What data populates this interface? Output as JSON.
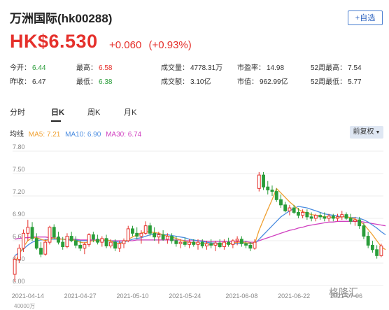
{
  "header": {
    "title": "万洲国际(hk00288)",
    "follow_label": "+自选"
  },
  "quote": {
    "price": "HK$6.530",
    "change": "+0.060",
    "change_pct": "(+0.93%)"
  },
  "stats": [
    {
      "label": "今开：",
      "value": "6.44",
      "color": "green"
    },
    {
      "label": "最高：",
      "value": "6.58",
      "color": "red"
    },
    {
      "label": "成交量：",
      "value": "4778.31万",
      "color": "none"
    },
    {
      "label": "市盈率：",
      "value": "14.98",
      "color": "none"
    },
    {
      "label": "52周最高：",
      "value": "7.54",
      "color": "none"
    },
    {
      "label": "昨收：",
      "value": "6.47",
      "color": "none"
    },
    {
      "label": "最低：",
      "value": "6.38",
      "color": "green"
    },
    {
      "label": "成交额：",
      "value": "3.10亿",
      "color": "none"
    },
    {
      "label": "市值：",
      "value": "962.99亿",
      "color": "none"
    },
    {
      "label": "52周最低：",
      "value": "5.77",
      "color": "none"
    }
  ],
  "tabs": [
    {
      "label": "分时"
    },
    {
      "label": "日K"
    },
    {
      "label": "周K"
    },
    {
      "label": "月K"
    }
  ],
  "ma_legend": {
    "label": "均线",
    "ma5": "MA5: 7.21",
    "ma10": "MA10: 6.90",
    "ma30": "MA30: 6.74",
    "ma5_color": "#f0a030",
    "ma10_color": "#4a8ce0",
    "ma30_color": "#d040c0"
  },
  "adjust_label": "前复权",
  "watermark": "格隆汇",
  "volume_label": "40000万",
  "chart_data": {
    "type": "candlestick",
    "y_ticks": [
      "7.80",
      "7.50",
      "7.20",
      "6.90",
      "6.60",
      "6.30",
      "6.00"
    ],
    "ylim": [
      6.0,
      7.8
    ],
    "x_ticks": [
      "2021-04-14",
      "2021-04-27",
      "2021-05-10",
      "2021-05-24",
      "2021-06-08",
      "2021-06-22",
      "2021-07-06"
    ],
    "up_color": "#e5302b",
    "down_color": "#2a9d3a",
    "candles": [
      {
        "o": 6.15,
        "h": 6.4,
        "l": 6.05,
        "c": 6.35
      },
      {
        "o": 6.35,
        "h": 6.55,
        "l": 6.3,
        "c": 6.5
      },
      {
        "o": 6.5,
        "h": 6.75,
        "l": 6.45,
        "c": 6.7
      },
      {
        "o": 6.7,
        "h": 6.88,
        "l": 6.6,
        "c": 6.78
      },
      {
        "o": 6.78,
        "h": 6.85,
        "l": 6.6,
        "c": 6.63
      },
      {
        "o": 6.63,
        "h": 6.7,
        "l": 6.48,
        "c": 6.5
      },
      {
        "o": 6.5,
        "h": 6.58,
        "l": 6.38,
        "c": 6.42
      },
      {
        "o": 6.42,
        "h": 6.62,
        "l": 6.4,
        "c": 6.58
      },
      {
        "o": 6.58,
        "h": 6.8,
        "l": 6.55,
        "c": 6.78
      },
      {
        "o": 6.78,
        "h": 6.82,
        "l": 6.62,
        "c": 6.65
      },
      {
        "o": 6.65,
        "h": 6.72,
        "l": 6.55,
        "c": 6.58
      },
      {
        "o": 6.58,
        "h": 6.65,
        "l": 6.48,
        "c": 6.52
      },
      {
        "o": 6.52,
        "h": 6.7,
        "l": 6.5,
        "c": 6.66
      },
      {
        "o": 6.66,
        "h": 6.72,
        "l": 6.58,
        "c": 6.6
      },
      {
        "o": 6.6,
        "h": 6.66,
        "l": 6.5,
        "c": 6.54
      },
      {
        "o": 6.54,
        "h": 6.6,
        "l": 6.46,
        "c": 6.5
      },
      {
        "o": 6.5,
        "h": 6.58,
        "l": 6.42,
        "c": 6.55
      },
      {
        "o": 6.55,
        "h": 6.7,
        "l": 6.52,
        "c": 6.68
      },
      {
        "o": 6.68,
        "h": 6.72,
        "l": 6.58,
        "c": 6.62
      },
      {
        "o": 6.62,
        "h": 6.68,
        "l": 6.55,
        "c": 6.58
      },
      {
        "o": 6.58,
        "h": 6.66,
        "l": 6.52,
        "c": 6.63
      },
      {
        "o": 6.63,
        "h": 6.68,
        "l": 6.5,
        "c": 6.53
      },
      {
        "o": 6.53,
        "h": 6.62,
        "l": 6.5,
        "c": 6.58
      },
      {
        "o": 6.58,
        "h": 6.62,
        "l": 6.46,
        "c": 6.5
      },
      {
        "o": 6.5,
        "h": 6.6,
        "l": 6.45,
        "c": 6.56
      },
      {
        "o": 6.56,
        "h": 6.63,
        "l": 6.5,
        "c": 6.6
      },
      {
        "o": 6.6,
        "h": 6.8,
        "l": 6.58,
        "c": 6.76
      },
      {
        "o": 6.76,
        "h": 6.8,
        "l": 6.66,
        "c": 6.7
      },
      {
        "o": 6.7,
        "h": 6.78,
        "l": 6.62,
        "c": 6.66
      },
      {
        "o": 6.66,
        "h": 6.74,
        "l": 6.56,
        "c": 6.7
      },
      {
        "o": 6.7,
        "h": 6.86,
        "l": 6.68,
        "c": 6.8
      },
      {
        "o": 6.8,
        "h": 6.84,
        "l": 6.66,
        "c": 6.7
      },
      {
        "o": 6.7,
        "h": 6.78,
        "l": 6.6,
        "c": 6.65
      },
      {
        "o": 6.65,
        "h": 6.72,
        "l": 6.56,
        "c": 6.68
      },
      {
        "o": 6.68,
        "h": 6.74,
        "l": 6.6,
        "c": 6.62
      },
      {
        "o": 6.62,
        "h": 6.7,
        "l": 6.56,
        "c": 6.66
      },
      {
        "o": 6.66,
        "h": 6.7,
        "l": 6.56,
        "c": 6.6
      },
      {
        "o": 6.6,
        "h": 6.66,
        "l": 6.52,
        "c": 6.56
      },
      {
        "o": 6.56,
        "h": 6.62,
        "l": 6.5,
        "c": 6.58
      },
      {
        "o": 6.58,
        "h": 6.64,
        "l": 6.52,
        "c": 6.55
      },
      {
        "o": 6.55,
        "h": 6.62,
        "l": 6.5,
        "c": 6.58
      },
      {
        "o": 6.58,
        "h": 6.62,
        "l": 6.52,
        "c": 6.55
      },
      {
        "o": 6.55,
        "h": 6.62,
        "l": 6.48,
        "c": 6.58
      },
      {
        "o": 6.58,
        "h": 6.62,
        "l": 6.5,
        "c": 6.53
      },
      {
        "o": 6.53,
        "h": 6.6,
        "l": 6.48,
        "c": 6.56
      },
      {
        "o": 6.56,
        "h": 6.62,
        "l": 6.5,
        "c": 6.54
      },
      {
        "o": 6.54,
        "h": 6.6,
        "l": 6.46,
        "c": 6.57
      },
      {
        "o": 6.57,
        "h": 6.62,
        "l": 6.5,
        "c": 6.52
      },
      {
        "o": 6.52,
        "h": 6.62,
        "l": 6.48,
        "c": 6.58
      },
      {
        "o": 6.58,
        "h": 6.64,
        "l": 6.52,
        "c": 6.55
      },
      {
        "o": 6.55,
        "h": 6.62,
        "l": 6.5,
        "c": 6.6
      },
      {
        "o": 6.6,
        "h": 6.66,
        "l": 6.54,
        "c": 6.62
      },
      {
        "o": 6.62,
        "h": 6.66,
        "l": 6.52,
        "c": 6.56
      },
      {
        "o": 6.56,
        "h": 6.6,
        "l": 6.5,
        "c": 6.54
      },
      {
        "o": 6.54,
        "h": 6.58,
        "l": 6.46,
        "c": 6.5
      },
      {
        "o": 6.5,
        "h": 6.62,
        "l": 6.48,
        "c": 6.58
      },
      {
        "o": 7.3,
        "h": 7.52,
        "l": 7.26,
        "c": 7.48
      },
      {
        "o": 7.48,
        "h": 7.52,
        "l": 7.28,
        "c": 7.32
      },
      {
        "o": 7.32,
        "h": 7.4,
        "l": 7.22,
        "c": 7.28
      },
      {
        "o": 7.28,
        "h": 7.34,
        "l": 7.2,
        "c": 7.26
      },
      {
        "o": 7.26,
        "h": 7.3,
        "l": 7.12,
        "c": 7.15
      },
      {
        "o": 7.15,
        "h": 7.22,
        "l": 7.04,
        "c": 7.08
      },
      {
        "o": 7.08,
        "h": 7.12,
        "l": 6.98,
        "c": 7.0
      },
      {
        "o": 7.0,
        "h": 7.08,
        "l": 6.94,
        "c": 7.04
      },
      {
        "o": 7.04,
        "h": 7.08,
        "l": 6.96,
        "c": 6.98
      },
      {
        "o": 6.98,
        "h": 7.04,
        "l": 6.9,
        "c": 6.94
      },
      {
        "o": 6.94,
        "h": 7.02,
        "l": 6.9,
        "c": 6.98
      },
      {
        "o": 6.98,
        "h": 7.02,
        "l": 6.88,
        "c": 6.92
      },
      {
        "o": 6.92,
        "h": 6.98,
        "l": 6.86,
        "c": 6.9
      },
      {
        "o": 6.9,
        "h": 6.96,
        "l": 6.86,
        "c": 6.94
      },
      {
        "o": 6.94,
        "h": 6.98,
        "l": 6.88,
        "c": 6.92
      },
      {
        "o": 6.92,
        "h": 6.98,
        "l": 6.86,
        "c": 6.9
      },
      {
        "o": 6.9,
        "h": 6.96,
        "l": 6.86,
        "c": 6.93
      },
      {
        "o": 6.93,
        "h": 6.96,
        "l": 6.86,
        "c": 6.9
      },
      {
        "o": 6.9,
        "h": 6.96,
        "l": 6.86,
        "c": 6.92
      },
      {
        "o": 6.92,
        "h": 7.0,
        "l": 6.88,
        "c": 6.95
      },
      {
        "o": 6.95,
        "h": 6.98,
        "l": 6.88,
        "c": 6.9
      },
      {
        "o": 6.9,
        "h": 6.96,
        "l": 6.82,
        "c": 6.86
      },
      {
        "o": 6.86,
        "h": 6.92,
        "l": 6.8,
        "c": 6.88
      },
      {
        "o": 6.88,
        "h": 6.92,
        "l": 6.76,
        "c": 6.8
      },
      {
        "o": 6.8,
        "h": 6.84,
        "l": 6.62,
        "c": 6.66
      },
      {
        "o": 6.66,
        "h": 6.72,
        "l": 6.5,
        "c": 6.54
      },
      {
        "o": 6.54,
        "h": 6.6,
        "l": 6.44,
        "c": 6.48
      },
      {
        "o": 6.48,
        "h": 6.54,
        "l": 6.36,
        "c": 6.4
      },
      {
        "o": 6.4,
        "h": 6.56,
        "l": 6.38,
        "c": 6.53
      }
    ],
    "ma5": [
      6.3,
      6.42,
      6.52,
      6.6,
      6.64,
      6.64,
      6.62,
      6.6,
      6.62,
      6.64,
      6.62,
      6.62,
      6.62,
      6.62,
      6.6,
      6.58,
      6.57,
      6.59,
      6.6,
      6.6,
      6.61,
      6.61,
      6.6,
      6.57,
      6.56,
      6.58,
      6.62,
      6.65,
      6.68,
      6.7,
      6.72,
      6.72,
      6.71,
      6.7,
      6.68,
      6.66,
      6.65,
      6.63,
      6.61,
      6.59,
      6.58,
      6.57,
      6.57,
      6.56,
      6.56,
      6.55,
      6.56,
      6.55,
      6.56,
      6.56,
      6.57,
      6.58,
      6.58,
      6.57,
      6.57,
      6.56,
      6.74,
      6.88,
      7.02,
      7.15,
      7.3,
      7.24,
      7.18,
      7.12,
      7.07,
      7.02,
      6.99,
      6.97,
      6.95,
      6.94,
      6.93,
      6.92,
      6.92,
      6.91,
      6.91,
      6.92,
      6.92,
      6.91,
      6.89,
      6.86,
      6.82,
      6.75,
      6.68,
      6.6,
      6.52,
      6.48
    ],
    "ma10": [
      6.4,
      6.44,
      6.49,
      6.54,
      6.58,
      6.6,
      6.61,
      6.61,
      6.62,
      6.62,
      6.62,
      6.62,
      6.61,
      6.61,
      6.61,
      6.6,
      6.6,
      6.6,
      6.6,
      6.6,
      6.6,
      6.6,
      6.6,
      6.59,
      6.58,
      6.58,
      6.6,
      6.62,
      6.63,
      6.64,
      6.66,
      6.68,
      6.69,
      6.69,
      6.68,
      6.68,
      6.67,
      6.66,
      6.65,
      6.64,
      6.62,
      6.61,
      6.6,
      6.59,
      6.58,
      6.57,
      6.57,
      6.56,
      6.56,
      6.56,
      6.56,
      6.56,
      6.57,
      6.57,
      6.56,
      6.56,
      6.62,
      6.68,
      6.74,
      6.8,
      6.86,
      6.92,
      6.96,
      7.0,
      7.03,
      7.06,
      7.05,
      7.04,
      7.02,
      7.0,
      6.98,
      6.96,
      6.95,
      6.94,
      6.93,
      6.92,
      6.92,
      6.91,
      6.91,
      6.9,
      6.88,
      6.85,
      6.81,
      6.77,
      6.72,
      6.68
    ],
    "ma30": [
      6.62,
      6.63,
      6.64,
      6.64,
      6.65,
      6.65,
      6.65,
      6.65,
      6.64,
      6.64,
      6.63,
      6.62,
      6.62,
      6.62,
      6.62,
      6.61,
      6.61,
      6.61,
      6.61,
      6.61,
      6.61,
      6.61,
      6.6,
      6.6,
      6.6,
      6.6,
      6.6,
      6.6,
      6.61,
      6.61,
      6.61,
      6.61,
      6.61,
      6.61,
      6.61,
      6.61,
      6.61,
      6.61,
      6.61,
      6.6,
      6.6,
      6.6,
      6.6,
      6.6,
      6.59,
      6.59,
      6.59,
      6.59,
      6.59,
      6.59,
      6.59,
      6.59,
      6.59,
      6.59,
      6.58,
      6.58,
      6.6,
      6.62,
      6.64,
      6.66,
      6.68,
      6.7,
      6.72,
      6.74,
      6.75,
      6.77,
      6.78,
      6.8,
      6.81,
      6.82,
      6.83,
      6.84,
      6.85,
      6.85,
      6.86,
      6.86,
      6.86,
      6.86,
      6.86,
      6.86,
      6.85,
      6.84,
      6.83,
      6.82,
      6.81,
      6.8
    ]
  }
}
